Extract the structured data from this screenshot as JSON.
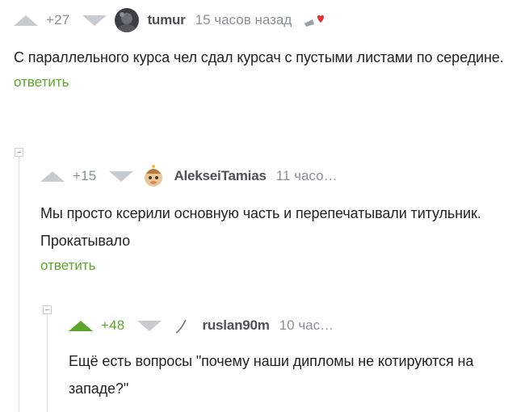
{
  "comments": [
    {
      "rating": "+27",
      "author": "tumur",
      "time": "15 часов назад",
      "text": "С параллельного курса чел сдал курсач с пустыми листами по середине.",
      "reply": "ответить"
    },
    {
      "rating": "+15",
      "author": "AlekseiTamias",
      "time": "11 часо…",
      "text": "Мы просто ксерили основную часть и перепечатывали титульник. Прокатывало",
      "reply": "ответить"
    },
    {
      "rating": "+48",
      "author": "ruslan90m",
      "time": "10 час…",
      "text": "Ещё есть вопросы \"почему наши дипломы не котируются на западе?\""
    }
  ],
  "colors": {
    "accent": "#5aa72c",
    "muted": "#8a9196",
    "arrow": "#c9cccf"
  },
  "icons": {
    "upvote": "triangle-up-icon",
    "downvote": "triangle-down-icon",
    "badge": "heart-badge-icon",
    "collapse": "minus-square-icon"
  }
}
